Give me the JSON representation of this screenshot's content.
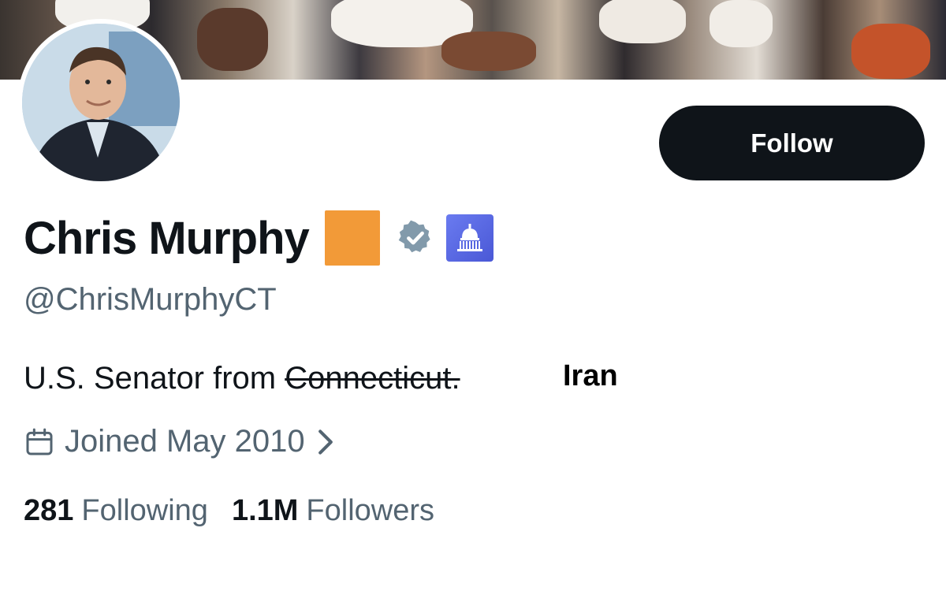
{
  "profile": {
    "display_name": "Chris Murphy",
    "handle": "@ChrisMurphyCT",
    "follow_label": "Follow",
    "bio_prefix": "U.S. Senator from ",
    "bio_struck": "Connecticut.",
    "bio_overlay": "Iran",
    "joined": "Joined May 2010",
    "following_count": "281",
    "following_label": "Following",
    "followers_count": "1.1M",
    "followers_label": "Followers"
  },
  "icons": {
    "verified": "verified-badge-icon",
    "affiliation": "capitol-building-icon",
    "calendar": "calendar-icon",
    "chevron": "chevron-right-icon",
    "emoji": "orange-square-emoji"
  },
  "colors": {
    "text_primary": "#0f1419",
    "text_secondary": "#536471",
    "button_bg": "#0f1419",
    "emoji_orange": "#f29a38",
    "verified_gray": "#829aab",
    "gov_badge": "#5b69e6"
  }
}
